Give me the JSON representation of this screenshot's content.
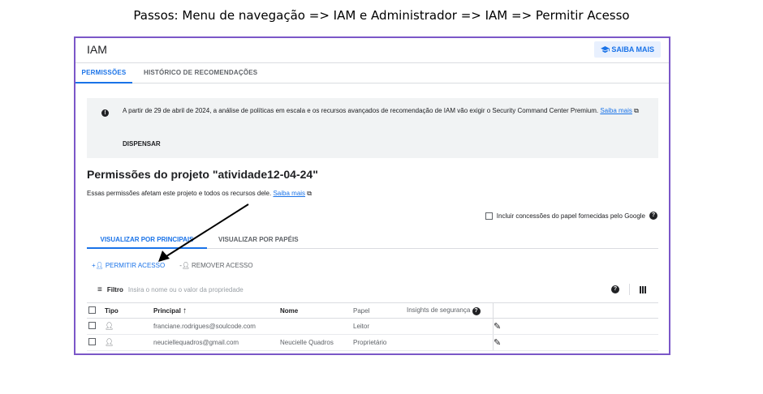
{
  "caption": "Passos: Menu de navegação => IAM e Administrador => IAM => Permitir Acesso",
  "header": {
    "title": "IAM",
    "saiba_mais": "SAIBA MAIS"
  },
  "tabs": [
    {
      "label": "PERMISSÕES",
      "active": true
    },
    {
      "label": "HISTÓRICO DE RECOMENDAÇÕES",
      "active": false
    }
  ],
  "banner": {
    "message": "A partir de 29 de abril de 2024, a análise de políticas em escala e os recursos avançados de recomendação de IAM vão exigir o Security Command Center Premium.",
    "link": "Saiba mais",
    "dismiss": "DISPENSAR"
  },
  "project": {
    "title": "Permissões do projeto \"atividade12-04-24\"",
    "subtitle": "Essas permissões afetam este projeto e todos os recursos dele.",
    "subtitle_link": "Saiba mais"
  },
  "include_google_grants": {
    "label": "Incluir concessões do papel fornecidas pelo Google",
    "checked": false
  },
  "view_tabs": [
    {
      "label": "VISUALIZAR POR PRINCIPAIS",
      "active": true
    },
    {
      "label": "VISUALIZAR POR PAPÉIS",
      "active": false
    }
  ],
  "actions": {
    "grant": "PERMITIR ACESSO",
    "remove": "REMOVER ACESSO"
  },
  "filter": {
    "label": "Filtro",
    "placeholder": "Insira o nome ou o valor da propriedade"
  },
  "table": {
    "headers": {
      "type": "Tipo",
      "principal": "Principal",
      "name": "Nome",
      "role": "Papel",
      "insights": "Insights de segurança"
    },
    "rows": [
      {
        "principal": "franciane.rodrigues@soulcode.com",
        "name": "",
        "role": "Leitor"
      },
      {
        "principal": "neuciellequadros@gmail.com",
        "name": "Neucielle Quadros",
        "role": "Proprietário"
      }
    ]
  },
  "colors": {
    "accent": "#1a73e8",
    "frame": "#7b57c8",
    "banner_bg": "#f1f3f4"
  }
}
